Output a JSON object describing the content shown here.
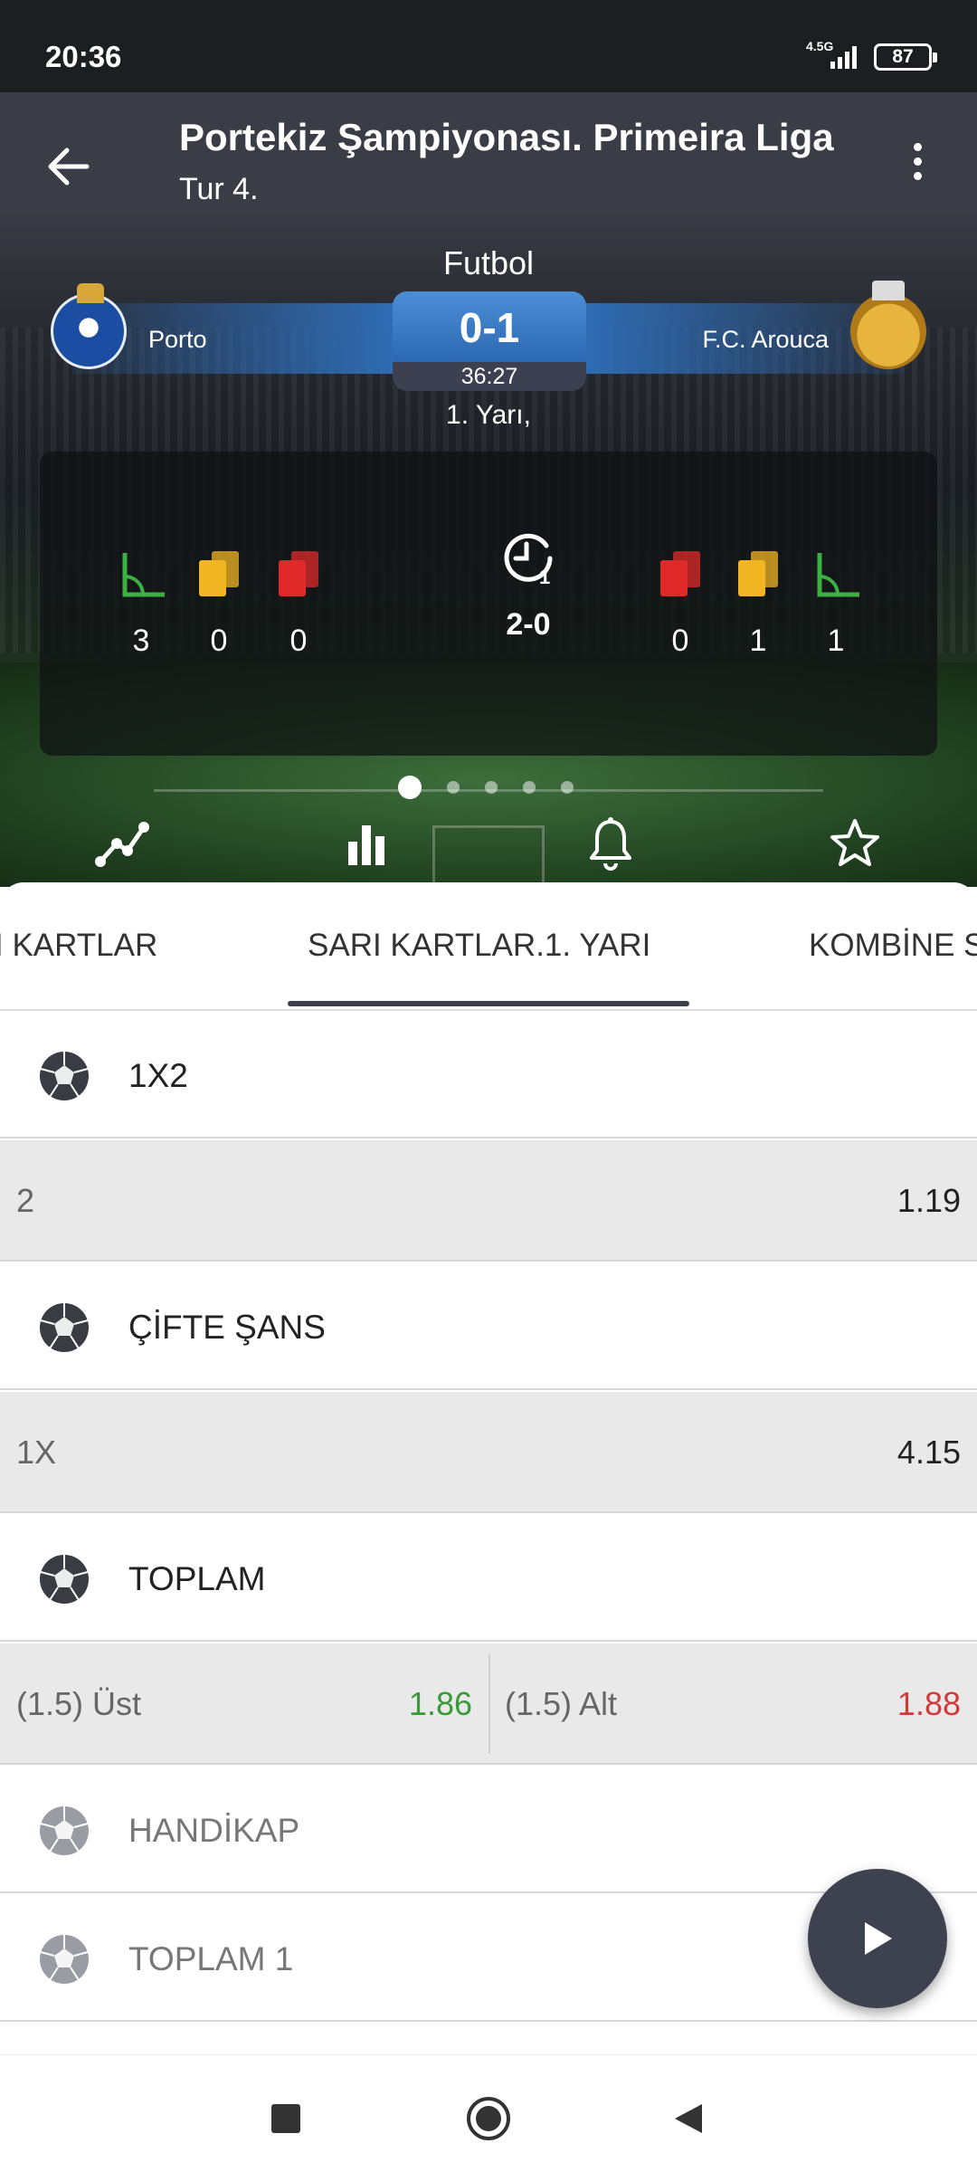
{
  "status_bar": {
    "time": "20:36",
    "network": "4.5G",
    "battery": "87"
  },
  "header": {
    "title": "Portekiz Şampiyonası. Primeira Liga",
    "subtitle": "Tur 4."
  },
  "match": {
    "sport": "Futbol",
    "home_team": "Porto",
    "away_team": "F.C. Arouca",
    "score": "0-1",
    "clock": "36:27",
    "period": "1. Yarı,"
  },
  "stats": {
    "home": {
      "corners": "3",
      "yellow_cards": "0",
      "red_cards": "0"
    },
    "away": {
      "red_cards": "0",
      "yellow_cards": "1",
      "corners": "1"
    },
    "half_time_marker": "1",
    "half_time_score": "2-0"
  },
  "pager": {
    "count": 5,
    "active": 0
  },
  "tabs": {
    "left_partial": "I KARTLAR",
    "active": "SARI KARTLAR.1. YARI",
    "right_partial": "KOMBİNE S"
  },
  "markets": [
    {
      "name": "1X2",
      "row": {
        "key": "2",
        "odd": "1.19"
      }
    },
    {
      "name": "ÇİFTE ŞANS",
      "row": {
        "key": "1X",
        "odd": "4.15"
      }
    },
    {
      "name": "TOPLAM",
      "left": {
        "key": "(1.5) Üst",
        "odd": "1.86"
      },
      "right": {
        "key": "(1.5) Alt",
        "odd": "1.88"
      }
    },
    {
      "name": "HANDİKAP"
    },
    {
      "name": "TOPLAM 1"
    }
  ],
  "colors": {
    "accent_blue": "#2c68b3",
    "yellow_card": "#f2b624",
    "red_card": "#e02a2a",
    "corner_green": "#3cb043",
    "odd_up": "#3a9a3a",
    "odd_down": "#d23a3a"
  }
}
